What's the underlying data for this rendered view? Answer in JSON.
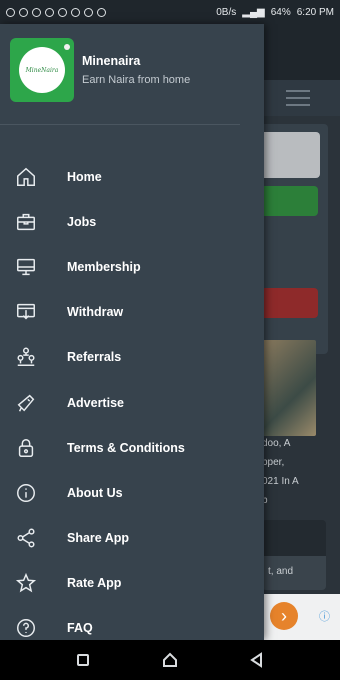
{
  "status_bar": {
    "network_speed": "0B/s",
    "battery": "64%",
    "time": "6:20 PM"
  },
  "drawer": {
    "app_name": "Minenaira",
    "tagline": "Earn Naira from home",
    "logo_text": "MineNaira",
    "menu": [
      {
        "label": "Home",
        "icon": "home-icon"
      },
      {
        "label": "Jobs",
        "icon": "briefcase-icon"
      },
      {
        "label": "Membership",
        "icon": "monitor-icon"
      },
      {
        "label": "Withdraw",
        "icon": "withdraw-icon"
      },
      {
        "label": "Referrals",
        "icon": "network-icon"
      },
      {
        "label": "Advertise",
        "icon": "megaphone-icon"
      },
      {
        "label": "Terms & Conditions",
        "icon": "lock-icon"
      },
      {
        "label": "About Us",
        "icon": "info-icon"
      },
      {
        "label": "Share App",
        "icon": "share-icon"
      },
      {
        "label": "Rate App",
        "icon": "star-icon"
      },
      {
        "label": "FAQ",
        "icon": "help-icon"
      }
    ]
  },
  "background": {
    "article_lines": [
      "doo, A",
      "pper,",
      "021 In A",
      "b"
    ],
    "card_text": "t, and"
  },
  "colors": {
    "drawer_bg": "#37434d",
    "accent_green": "#2da64a"
  }
}
